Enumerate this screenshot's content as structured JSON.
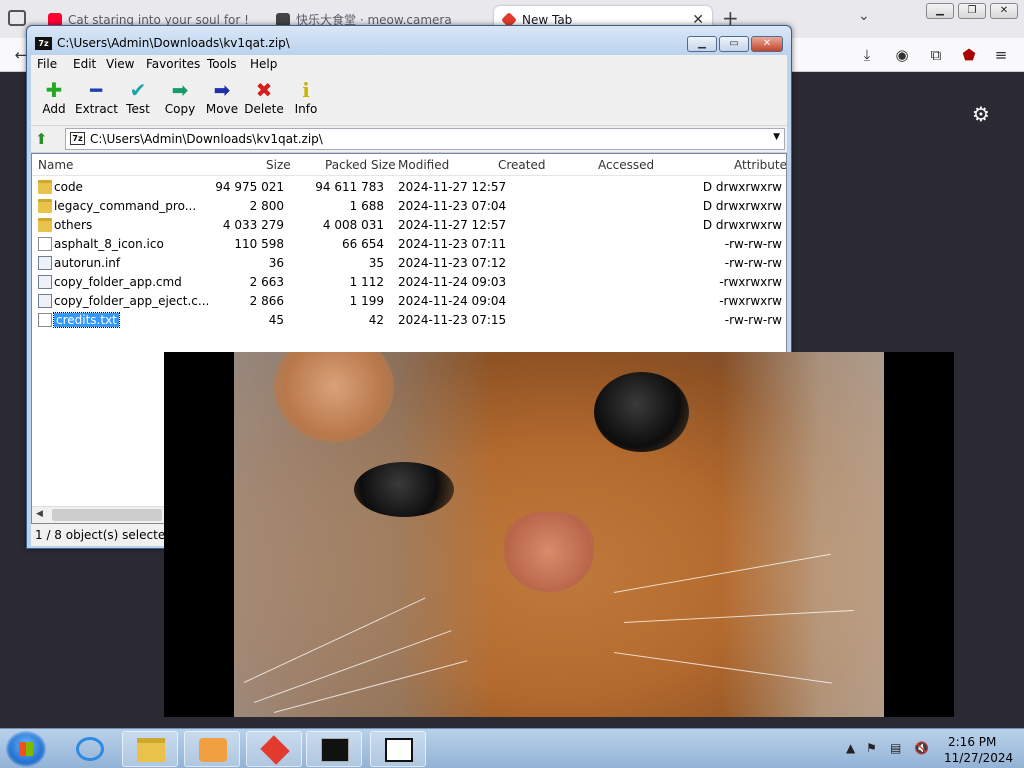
{
  "browser": {
    "tabs": [
      {
        "label": "Cat staring into your soul for !",
        "active": false
      },
      {
        "label": "快乐大食堂 · meow.camera",
        "active": false
      },
      {
        "label": "New Tab",
        "active": true
      }
    ]
  },
  "zip": {
    "title": "C:\\Users\\Admin\\Downloads\\kv1qat.zip\\",
    "menu": [
      "File",
      "Edit",
      "View",
      "Favorites",
      "Tools",
      "Help"
    ],
    "toolbar": [
      {
        "label": "Add",
        "icon": "add-icon",
        "color": "#22aa22"
      },
      {
        "label": "Extract",
        "icon": "extract-icon",
        "color": "#1e3fae"
      },
      {
        "label": "Test",
        "icon": "test-icon",
        "color": "#1aa7a7"
      },
      {
        "label": "Copy",
        "icon": "copy-icon",
        "color": "#1a9a6a"
      },
      {
        "label": "Move",
        "icon": "move-icon",
        "color": "#1e2fa8"
      },
      {
        "label": "Delete",
        "icon": "delete-icon",
        "color": "#d61c1c"
      },
      {
        "label": "Info",
        "icon": "info-icon",
        "color": "#c8b400"
      }
    ],
    "address": "C:\\Users\\Admin\\Downloads\\kv1qat.zip\\",
    "columns": [
      "Name",
      "Size",
      "Packed Size",
      "Modified",
      "Created",
      "Accessed",
      "Attribute"
    ],
    "rows": [
      {
        "name": "code",
        "size": "94 975 021",
        "packed": "94 611 783",
        "modified": "2024-11-27 12:57",
        "attr": "D drwxrwxrw",
        "kind": "folder"
      },
      {
        "name": "legacy_command_pro...",
        "size": "2 800",
        "packed": "1 688",
        "modified": "2024-11-23 07:04",
        "attr": "D drwxrwxrw",
        "kind": "folder"
      },
      {
        "name": "others",
        "size": "4 033 279",
        "packed": "4 008 031",
        "modified": "2024-11-27 12:57",
        "attr": "D drwxrwxrw",
        "kind": "folder"
      },
      {
        "name": "asphalt_8_icon.ico",
        "size": "110 598",
        "packed": "66 654",
        "modified": "2024-11-23 07:11",
        "attr": "-rw-rw-rw",
        "kind": "file"
      },
      {
        "name": "autorun.inf",
        "size": "36",
        "packed": "35",
        "modified": "2024-11-23 07:12",
        "attr": "-rw-rw-rw",
        "kind": "gear"
      },
      {
        "name": "copy_folder_app.cmd",
        "size": "2 663",
        "packed": "1 112",
        "modified": "2024-11-24 09:03",
        "attr": "-rwxrwxrw",
        "kind": "gear"
      },
      {
        "name": "copy_folder_app_eject.c...",
        "size": "2 866",
        "packed": "1 199",
        "modified": "2024-11-24 09:04",
        "attr": "-rwxrwxrw",
        "kind": "gear"
      },
      {
        "name": "credits.txt",
        "size": "45",
        "packed": "42",
        "modified": "2024-11-23 07:15",
        "attr": "-rw-rw-rw",
        "kind": "file",
        "selected": true
      }
    ],
    "status": "1 / 8 object(s) selected"
  },
  "taskbar": {
    "time": "2:16 PM",
    "date": "11/27/2024"
  }
}
